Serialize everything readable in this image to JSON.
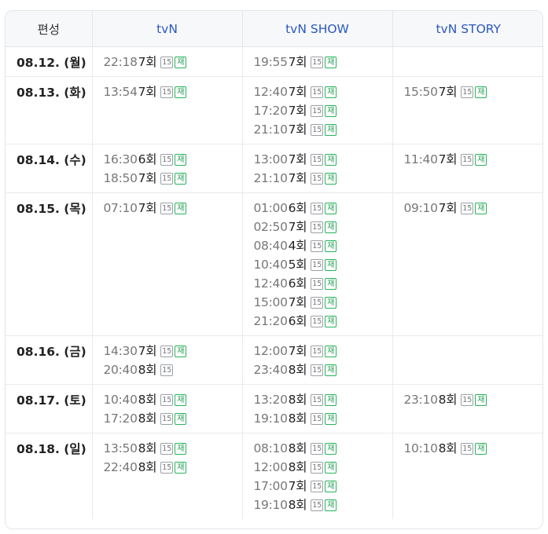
{
  "header": {
    "schedule": "편성",
    "channels": [
      "tvN",
      "tvN SHOW",
      "tvN STORY"
    ]
  },
  "colors": {
    "channel_header": "#2a58c2",
    "rerun_badge": "#25b35a"
  },
  "icons": {
    "age_rating": "age-15-badge-icon",
    "rerun": "rerun-badge-icon"
  },
  "rows": [
    {
      "date": "08.12. (월)",
      "tvn": [
        {
          "time": "22:18",
          "episode": "7회",
          "rating": "15",
          "rerun": "재"
        }
      ],
      "tvn_show": [
        {
          "time": "19:55",
          "episode": "7회",
          "rating": "15",
          "rerun": "재"
        }
      ],
      "tvn_story": []
    },
    {
      "date": "08.13. (화)",
      "tvn": [
        {
          "time": "13:54",
          "episode": "7회",
          "rating": "15",
          "rerun": "재"
        }
      ],
      "tvn_show": [
        {
          "time": "12:40",
          "episode": "7회",
          "rating": "15",
          "rerun": "재"
        },
        {
          "time": "17:20",
          "episode": "7회",
          "rating": "15",
          "rerun": "재"
        },
        {
          "time": "21:10",
          "episode": "7회",
          "rating": "15",
          "rerun": "재"
        }
      ],
      "tvn_story": [
        {
          "time": "15:50",
          "episode": "7회",
          "rating": "15",
          "rerun": "재"
        }
      ]
    },
    {
      "date": "08.14. (수)",
      "tvn": [
        {
          "time": "16:30",
          "episode": "6회",
          "rating": "15",
          "rerun": "재"
        },
        {
          "time": "18:50",
          "episode": "7회",
          "rating": "15",
          "rerun": "재"
        }
      ],
      "tvn_show": [
        {
          "time": "13:00",
          "episode": "7회",
          "rating": "15",
          "rerun": "재"
        },
        {
          "time": "21:10",
          "episode": "7회",
          "rating": "15",
          "rerun": "재"
        }
      ],
      "tvn_story": [
        {
          "time": "11:40",
          "episode": "7회",
          "rating": "15",
          "rerun": "재"
        }
      ]
    },
    {
      "date": "08.15. (목)",
      "tvn": [
        {
          "time": "07:10",
          "episode": "7회",
          "rating": "15",
          "rerun": "재"
        }
      ],
      "tvn_show": [
        {
          "time": "01:00",
          "episode": "6회",
          "rating": "15",
          "rerun": "재"
        },
        {
          "time": "02:50",
          "episode": "7회",
          "rating": "15",
          "rerun": "재"
        },
        {
          "time": "08:40",
          "episode": "4회",
          "rating": "15",
          "rerun": "재"
        },
        {
          "time": "10:40",
          "episode": "5회",
          "rating": "15",
          "rerun": "재"
        },
        {
          "time": "12:40",
          "episode": "6회",
          "rating": "15",
          "rerun": "재"
        },
        {
          "time": "15:00",
          "episode": "7회",
          "rating": "15",
          "rerun": "재"
        },
        {
          "time": "21:20",
          "episode": "6회",
          "rating": "15",
          "rerun": "재"
        }
      ],
      "tvn_story": [
        {
          "time": "09:10",
          "episode": "7회",
          "rating": "15",
          "rerun": "재"
        }
      ]
    },
    {
      "date": "08.16. (금)",
      "tvn": [
        {
          "time": "14:30",
          "episode": "7회",
          "rating": "15",
          "rerun": "재"
        },
        {
          "time": "20:40",
          "episode": "8회",
          "rating": "15",
          "rerun": ""
        }
      ],
      "tvn_show": [
        {
          "time": "12:00",
          "episode": "7회",
          "rating": "15",
          "rerun": "재"
        },
        {
          "time": "23:40",
          "episode": "8회",
          "rating": "15",
          "rerun": "재"
        }
      ],
      "tvn_story": []
    },
    {
      "date": "08.17. (토)",
      "tvn": [
        {
          "time": "10:40",
          "episode": "8회",
          "rating": "15",
          "rerun": "재"
        },
        {
          "time": "17:20",
          "episode": "8회",
          "rating": "15",
          "rerun": "재"
        }
      ],
      "tvn_show": [
        {
          "time": "13:20",
          "episode": "8회",
          "rating": "15",
          "rerun": "재"
        },
        {
          "time": "19:10",
          "episode": "8회",
          "rating": "15",
          "rerun": "재"
        }
      ],
      "tvn_story": [
        {
          "time": "23:10",
          "episode": "8회",
          "rating": "15",
          "rerun": "재"
        }
      ]
    },
    {
      "date": "08.18. (일)",
      "tvn": [
        {
          "time": "13:50",
          "episode": "8회",
          "rating": "15",
          "rerun": "재"
        },
        {
          "time": "22:40",
          "episode": "8회",
          "rating": "15",
          "rerun": "재"
        }
      ],
      "tvn_show": [
        {
          "time": "08:10",
          "episode": "8회",
          "rating": "15",
          "rerun": "재"
        },
        {
          "time": "12:00",
          "episode": "8회",
          "rating": "15",
          "rerun": "재"
        },
        {
          "time": "17:00",
          "episode": "7회",
          "rating": "15",
          "rerun": "재"
        },
        {
          "time": "19:10",
          "episode": "8회",
          "rating": "15",
          "rerun": "재"
        }
      ],
      "tvn_story": [
        {
          "time": "10:10",
          "episode": "8회",
          "rating": "15",
          "rerun": "재"
        }
      ]
    }
  ]
}
